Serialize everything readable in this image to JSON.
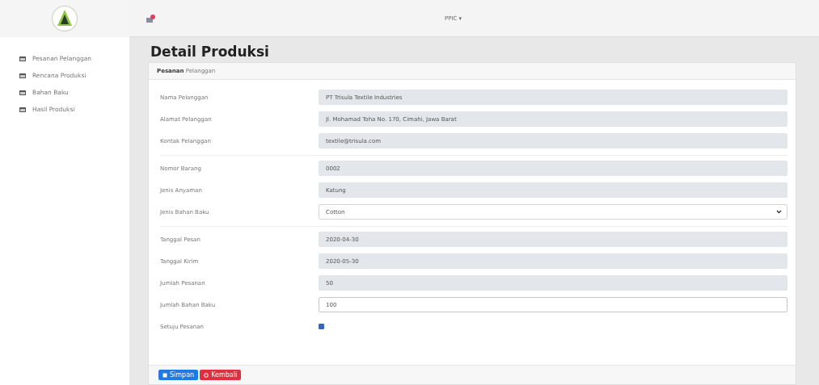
{
  "sidebar": {
    "items": [
      {
        "label": "Pesanan Pelanggan",
        "selected": false
      },
      {
        "label": "Rencana Produksi",
        "selected": false
      },
      {
        "label": "Bahan Baku",
        "selected": false
      },
      {
        "label": "Hasil Produksi",
        "selected": false
      }
    ]
  },
  "topbar": {
    "user": "PPIC",
    "caret": "▾"
  },
  "page_title": "Detail Produksi",
  "card": {
    "header": "**Pesanan** Pelanggan",
    "groups": [
      [
        {
          "kind": "input",
          "label": "Nama Pelanggan",
          "value": "PT Trisula Textile Industries",
          "readonly": true
        },
        {
          "kind": "input",
          "label": "Alamat Pelanggan",
          "value": "Jl. Mohamad Toha No. 170, Cimahi, Jawa Barat",
          "readonly": true
        },
        {
          "kind": "input",
          "label": "Kontak Pelanggan",
          "value": "textile@trisula.com",
          "readonly": true
        }
      ],
      [
        {
          "kind": "input",
          "label": "Nomor Barang",
          "value": "0002",
          "readonly": true
        },
        {
          "kind": "input",
          "label": "Jenis Anyaman",
          "value": "Katung",
          "readonly": true
        },
        {
          "kind": "select",
          "label": "Jenis Bahan Baku",
          "value": "Cotton",
          "readonly": false
        }
      ],
      [
        {
          "kind": "input",
          "label": "Tanggal Pesan",
          "value": "2020-04-30",
          "readonly": true
        },
        {
          "kind": "input",
          "label": "Tanggal Kirim",
          "value": "2020-05-30",
          "readonly": true
        },
        {
          "kind": "input",
          "label": "Jumlah Pesanan",
          "value": "50",
          "readonly": true
        },
        {
          "kind": "input",
          "label": "Jumlah Bahan Baku",
          "value": "100",
          "readonly": false
        },
        {
          "kind": "checkbox",
          "label": "Setuju Pesanan",
          "checked": true
        }
      ]
    ],
    "buttons": [
      {
        "label": "Simpan",
        "kind": "primary"
      },
      {
        "label": "Kembali",
        "kind": "danger"
      }
    ]
  }
}
